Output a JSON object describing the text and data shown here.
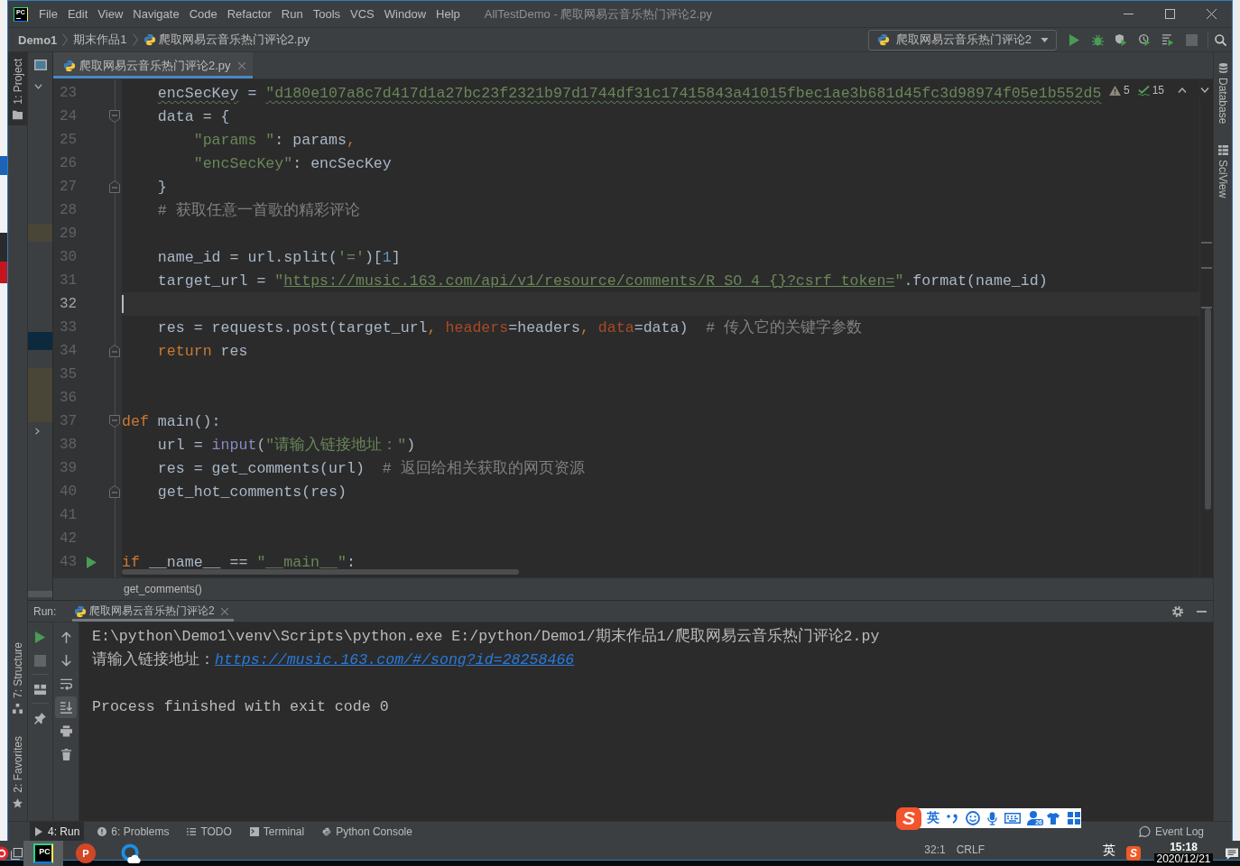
{
  "window": {
    "logo": "PC",
    "title": "AllTestDemo - 爬取网易云音乐热门评论2.py"
  },
  "menu": [
    "File",
    "Edit",
    "View",
    "Navigate",
    "Code",
    "Refactor",
    "Run",
    "Tools",
    "VCS",
    "Window",
    "Help"
  ],
  "navigation_bar": {
    "breadcrumbs": [
      {
        "kind": "project",
        "label": "Demo1"
      },
      {
        "kind": "folder",
        "label": "期末作品1"
      },
      {
        "kind": "file",
        "label": "爬取网易云音乐热门评论2.py"
      }
    ],
    "run_configuration": "爬取网易云音乐热门评论2",
    "actions": [
      {
        "kind": "run",
        "disabled": false
      },
      {
        "kind": "debug",
        "disabled": false
      },
      {
        "kind": "coverage",
        "disabled": false
      },
      {
        "kind": "profile",
        "disabled": false
      },
      {
        "kind": "concurrency",
        "disabled": false
      },
      {
        "kind": "stop",
        "disabled": true
      },
      {
        "kind": "search",
        "disabled": false
      }
    ]
  },
  "left_tool_strip": {
    "top": [
      {
        "kind": "project",
        "label": "1: Project",
        "selected": true
      }
    ],
    "bottom": [
      {
        "kind": "structure",
        "label": "7: Structure",
        "selected": false
      },
      {
        "kind": "favorites",
        "label": "2: Favorites",
        "selected": false
      }
    ]
  },
  "right_tool_strip": [
    {
      "kind": "database",
      "label": "Database"
    },
    {
      "kind": "sciview",
      "label": "SciView"
    }
  ],
  "editor": {
    "tabs": [
      {
        "label": "爬取网易云音乐热门评论2.py",
        "selected": true
      }
    ],
    "inspections": {
      "warnings": "5",
      "weak_warnings": "15"
    },
    "lines": [
      {
        "number": "23",
        "kind": "code",
        "current": false,
        "tokens": [
          {
            "kind": "typo",
            "text": "    encSecKey"
          },
          {
            "kind": "plain",
            "text": " = "
          },
          {
            "kind": "string_typo",
            "text": "\"d180e107a8c7d417d1a27bc23f2321b97d1744df31c17415843a41015fbec1ae3b681d45fc3d98974f05e1b552d5"
          }
        ]
      },
      {
        "number": "24",
        "kind": "fold_start",
        "current": false,
        "tokens": [
          {
            "kind": "plain",
            "text": "    data = {"
          }
        ]
      },
      {
        "number": "25",
        "kind": "code",
        "current": false,
        "tokens": [
          {
            "kind": "string",
            "text": "        \"params \""
          },
          {
            "kind": "plain",
            "text": ": params"
          },
          {
            "kind": "comma",
            "text": ","
          }
        ]
      },
      {
        "number": "26",
        "kind": "code",
        "current": false,
        "tokens": [
          {
            "kind": "string",
            "text": "        \"encSecKey\""
          },
          {
            "kind": "plain",
            "text": ": encSecKey"
          }
        ]
      },
      {
        "number": "27",
        "kind": "fold_end",
        "current": false,
        "tokens": [
          {
            "kind": "plain",
            "text": "    }"
          }
        ]
      },
      {
        "number": "28",
        "kind": "code",
        "current": false,
        "tokens": [
          {
            "kind": "comment",
            "text": "    # 获取任意一首歌的精彩评论"
          }
        ]
      },
      {
        "number": "29",
        "kind": "code",
        "current": false
      },
      {
        "number": "30",
        "kind": "code",
        "current": false,
        "tokens": [
          {
            "kind": "plain",
            "text": "    name_id = url.split("
          },
          {
            "kind": "string",
            "text": "'='"
          },
          {
            "kind": "plain",
            "text": ")["
          },
          {
            "kind": "number",
            "text": "1"
          },
          {
            "kind": "plain",
            "text": "]"
          }
        ]
      },
      {
        "number": "31",
        "kind": "code",
        "current": false,
        "tokens": [
          {
            "kind": "plain",
            "text": "    target_url = "
          },
          {
            "kind": "string",
            "text": "\""
          },
          {
            "kind": "link",
            "text": "https://music.163.com/api/v1/resource/comments/R_SO_4_{}?csrf_token="
          },
          {
            "kind": "string",
            "text": "\""
          },
          {
            "kind": "plain",
            "text": ".format(name_id)"
          }
        ]
      },
      {
        "number": "32",
        "kind": "code",
        "current": true
      },
      {
        "number": "33",
        "kind": "code",
        "current": false,
        "tokens": [
          {
            "kind": "plain",
            "text": "    res = requests.post(target_url"
          },
          {
            "kind": "comma",
            "text": ", "
          },
          {
            "kind": "param",
            "text": "headers"
          },
          {
            "kind": "plain",
            "text": "=headers"
          },
          {
            "kind": "comma",
            "text": ", "
          },
          {
            "kind": "param",
            "text": "data"
          },
          {
            "kind": "plain",
            "text": "=data)"
          },
          {
            "kind": "comment",
            "text": "  # 传入它的关键字参数"
          }
        ]
      },
      {
        "number": "34",
        "kind": "fold_end",
        "current": false,
        "tokens": [
          {
            "kind": "keyword",
            "text": "    return"
          },
          {
            "kind": "plain",
            "text": " res"
          }
        ]
      },
      {
        "number": "35",
        "kind": "code",
        "current": false
      },
      {
        "number": "36",
        "kind": "code",
        "current": false
      },
      {
        "number": "37",
        "kind": "fold_start",
        "current": false,
        "tokens": [
          {
            "kind": "keyword",
            "text": "def"
          },
          {
            "kind": "plain",
            "text": " main():"
          }
        ]
      },
      {
        "number": "38",
        "kind": "code",
        "current": false,
        "tokens": [
          {
            "kind": "plain",
            "text": "    url = "
          },
          {
            "kind": "builtin",
            "text": "input"
          },
          {
            "kind": "plain",
            "text": "("
          },
          {
            "kind": "string",
            "text": "\"请输入链接地址：\""
          },
          {
            "kind": "plain",
            "text": ")"
          }
        ]
      },
      {
        "number": "39",
        "kind": "code",
        "current": false,
        "tokens": [
          {
            "kind": "plain",
            "text": "    res = get_comments(url)"
          },
          {
            "kind": "comment",
            "text": "  # 返回给相关获取的网页资源"
          }
        ]
      },
      {
        "number": "40",
        "kind": "fold_end",
        "current": false,
        "tokens": [
          {
            "kind": "plain",
            "text": "    get_hot_comments(res)"
          }
        ]
      },
      {
        "number": "41",
        "kind": "code",
        "current": false
      },
      {
        "number": "42",
        "kind": "code",
        "current": false
      },
      {
        "number": "43",
        "kind": "run_entry",
        "current": false,
        "tokens": [
          {
            "kind": "keyword",
            "text": "if"
          },
          {
            "kind": "plain",
            "text": " __name__ == "
          },
          {
            "kind": "string",
            "text": "\"__main__\""
          },
          {
            "kind": "plain",
            "text": ":"
          }
        ]
      }
    ],
    "breadcrumb": "get_comments()"
  },
  "run_panel": {
    "label": "Run:",
    "tabs": [
      {
        "label": "爬取网易云音乐热门评论2",
        "selected": true
      }
    ],
    "left_actions": [
      {
        "kind": "rerun",
        "disabled": false
      },
      {
        "kind": "stop",
        "disabled": true
      },
      {
        "kind": "separator"
      },
      {
        "kind": "layout",
        "disabled": false
      },
      {
        "kind": "separator"
      },
      {
        "kind": "pin",
        "disabled": false
      }
    ],
    "console_actions": [
      {
        "kind": "up",
        "on": false
      },
      {
        "kind": "down",
        "on": false
      },
      {
        "kind": "soft_wrap",
        "on": false
      },
      {
        "kind": "scroll_to_end",
        "on": true
      },
      {
        "kind": "print",
        "on": false
      },
      {
        "kind": "clear",
        "on": false
      }
    ],
    "console": [
      {
        "kind": "output",
        "text": "E:\\python\\Demo1\\venv\\Scripts\\python.exe E:/python/Demo1/期末作品1/爬取网易云音乐热门评论2.py"
      },
      {
        "kind": "prompt",
        "text": "请输入链接地址：",
        "input": "https://music.163.com/#/song?id=28258466"
      },
      {
        "kind": "blank"
      },
      {
        "kind": "output",
        "text": "Process finished with exit code 0"
      }
    ]
  },
  "bottom_bar": {
    "tool_windows": [
      {
        "kind": "run",
        "label": "4: Run",
        "selected": true
      },
      {
        "kind": "problems",
        "label": "6: Problems",
        "selected": false
      },
      {
        "kind": "todo",
        "label": "TODO",
        "selected": false
      },
      {
        "kind": "terminal",
        "label": "Terminal",
        "selected": false
      },
      {
        "kind": "python_console",
        "label": "Python Console",
        "selected": false
      }
    ],
    "event_log": "Event Log"
  },
  "status_bar": [
    "32:1",
    "CRLF"
  ],
  "taskbar": {
    "apps": [
      {
        "kind": "red_circle",
        "selected": false
      },
      {
        "kind": "task_view",
        "selected": false
      },
      {
        "kind": "ide",
        "label": "PC",
        "selected": true
      },
      {
        "kind": "slides",
        "label": "P",
        "selected": false
      },
      {
        "kind": "cloud",
        "selected": false
      }
    ],
    "input_method": "英",
    "ime_logo": "S",
    "time": "15:18",
    "date": "2020/12/21"
  },
  "ime_toolbar": {
    "logo": "S",
    "mode": "英",
    "skin_count": "26"
  }
}
